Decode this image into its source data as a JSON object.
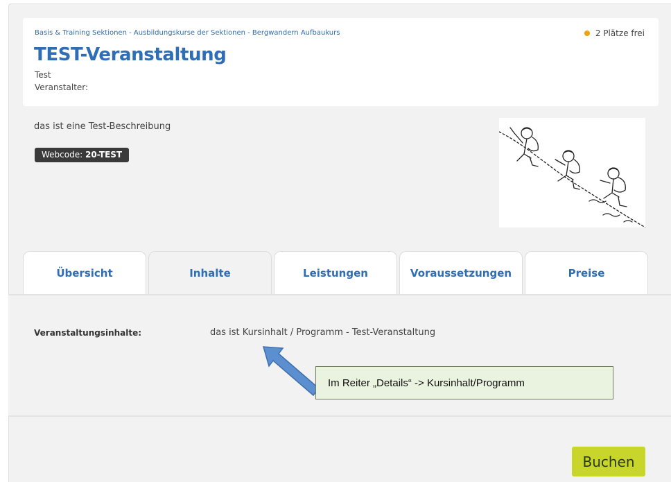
{
  "header": {
    "breadcrumb": "Basis & Training Sektionen - Ausbildungskurse der Sektionen - Bergwandern Aufbaukurs",
    "availability": "2 Plätze frei",
    "availability_color": "#f0a30a",
    "title": "TEST-Veranstaltung",
    "subtitle": "Test",
    "organizer_label": "Veranstalter:"
  },
  "description": "das ist eine Test-Beschreibung",
  "webcode": {
    "label": "Webcode:",
    "value": "20-TEST"
  },
  "illustration": {
    "icon": "hikers-illustration"
  },
  "tabs": [
    {
      "label": "Übersicht",
      "active": false
    },
    {
      "label": "Inhalte",
      "active": true
    },
    {
      "label": "Leistungen",
      "active": false
    },
    {
      "label": "Voraussetzungen",
      "active": false
    },
    {
      "label": "Preise",
      "active": false
    }
  ],
  "content": {
    "label": "Veranstaltungsinhalte:",
    "value": "das ist Kursinhalt / Programm - Test-Veranstaltung"
  },
  "annotation": {
    "text": "Im Reiter „Details“ -> Kursinhalt/Programm",
    "arrow_color": "#5b8fd0"
  },
  "actions": {
    "book_label": "Buchen",
    "book_color": "#c8d62b"
  }
}
